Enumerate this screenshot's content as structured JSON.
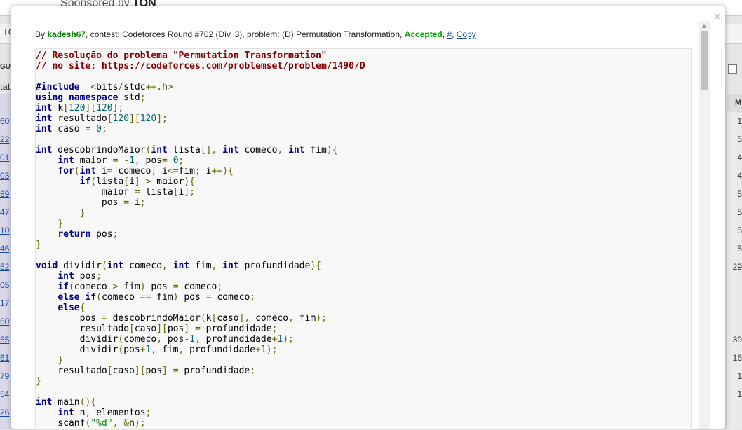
{
  "background": {
    "sponsor_prefix": "Sponsored by",
    "sponsor_brand": "TON",
    "nav_fragment": "TO",
    "gur_fragment": "GUR",
    "stat_fragment": "tat",
    "right_header": "M",
    "left_ids": [
      "60",
      "22",
      "01",
      "03",
      "89",
      "47",
      "10",
      "46",
      "52",
      "05",
      "17",
      "60",
      "55",
      "61",
      "79",
      "54",
      "26"
    ],
    "right_vals": [
      "1",
      "5",
      "4",
      "4",
      "5",
      "5",
      "5",
      "5",
      "29",
      "",
      "",
      "",
      "39",
      "16",
      "1",
      "1",
      ""
    ]
  },
  "submission": {
    "by_label": "By ",
    "author": "kadesh67",
    "contest_text": ", contest: Codeforces Round #702 (Div. 3), problem: (D) Permutation Transformation, ",
    "verdict": "Accepted",
    "sep1": ", ",
    "hash_link": "#",
    "sep2": ", ",
    "copy_link": "Copy",
    "close_symbol": "×"
  },
  "code_lines": [
    [
      [
        "cm",
        "// Resolução do problema \"Permutation Transformation\""
      ]
    ],
    [
      [
        "cm",
        "// no site: https://codeforces.com/problemset/problem/1490/D"
      ]
    ],
    [],
    [
      [
        "kw",
        "#include"
      ],
      [
        "",
        "  "
      ],
      [
        "pun",
        "<"
      ],
      [
        "",
        "bits"
      ],
      [
        "pun",
        "/"
      ],
      [
        "",
        "stdc"
      ],
      [
        "pun",
        "++."
      ],
      [
        "",
        "h"
      ],
      [
        "pun",
        ">"
      ]
    ],
    [
      [
        "kw",
        "using"
      ],
      [
        "",
        " "
      ],
      [
        "kw",
        "namespace"
      ],
      [
        "",
        " std"
      ],
      [
        "pun",
        ";"
      ]
    ],
    [
      [
        "kw",
        "int"
      ],
      [
        "",
        " k"
      ],
      [
        "pun",
        "["
      ],
      [
        "num",
        "120"
      ],
      [
        "pun",
        "]["
      ],
      [
        "num",
        "120"
      ],
      [
        "pun",
        "];"
      ]
    ],
    [
      [
        "kw",
        "int"
      ],
      [
        "",
        " resultado"
      ],
      [
        "pun",
        "["
      ],
      [
        "num",
        "120"
      ],
      [
        "pun",
        "]["
      ],
      [
        "num",
        "120"
      ],
      [
        "pun",
        "];"
      ]
    ],
    [
      [
        "kw",
        "int"
      ],
      [
        "",
        " caso "
      ],
      [
        "pun",
        "="
      ],
      [
        "",
        " "
      ],
      [
        "num",
        "0"
      ],
      [
        "pun",
        ";"
      ]
    ],
    [],
    [
      [
        "kw",
        "int"
      ],
      [
        "",
        " descobrindoMaior"
      ],
      [
        "pun",
        "("
      ],
      [
        "kw",
        "int"
      ],
      [
        "",
        " lista"
      ],
      [
        "pun",
        "[],"
      ],
      [
        "",
        " "
      ],
      [
        "kw",
        "int"
      ],
      [
        "",
        " comeco"
      ],
      [
        "pun",
        ","
      ],
      [
        "",
        " "
      ],
      [
        "kw",
        "int"
      ],
      [
        "",
        " fim"
      ],
      [
        "pun",
        "){"
      ]
    ],
    [
      [
        "",
        "    "
      ],
      [
        "kw",
        "int"
      ],
      [
        "",
        " maior "
      ],
      [
        "pun",
        "="
      ],
      [
        "",
        " "
      ],
      [
        "pun",
        "-"
      ],
      [
        "num",
        "1"
      ],
      [
        "pun",
        ","
      ],
      [
        "",
        " pos"
      ],
      [
        "pun",
        "="
      ],
      [
        "",
        " "
      ],
      [
        "num",
        "0"
      ],
      [
        "pun",
        ";"
      ]
    ],
    [
      [
        "",
        "    "
      ],
      [
        "kw",
        "for"
      ],
      [
        "pun",
        "("
      ],
      [
        "kw",
        "int"
      ],
      [
        "",
        " i"
      ],
      [
        "pun",
        "="
      ],
      [
        "",
        " comeco"
      ],
      [
        "pun",
        ";"
      ],
      [
        "",
        " i"
      ],
      [
        "pun",
        "<="
      ],
      [
        "",
        "fim"
      ],
      [
        "pun",
        ";"
      ],
      [
        "",
        " i"
      ],
      [
        "pun",
        "++){"
      ]
    ],
    [
      [
        "",
        "        "
      ],
      [
        "kw",
        "if"
      ],
      [
        "pun",
        "("
      ],
      [
        "",
        "lista"
      ],
      [
        "pun",
        "["
      ],
      [
        "",
        "i"
      ],
      [
        "pun",
        "]"
      ],
      [
        "",
        " "
      ],
      [
        "pun",
        ">"
      ],
      [
        "",
        " maior"
      ],
      [
        "pun",
        "){"
      ]
    ],
    [
      [
        "",
        "            maior "
      ],
      [
        "pun",
        "="
      ],
      [
        "",
        " lista"
      ],
      [
        "pun",
        "["
      ],
      [
        "",
        "i"
      ],
      [
        "pun",
        "];"
      ]
    ],
    [
      [
        "",
        "            pos "
      ],
      [
        "pun",
        "="
      ],
      [
        "",
        " i"
      ],
      [
        "pun",
        ";"
      ]
    ],
    [
      [
        "",
        "        "
      ],
      [
        "pun",
        "}"
      ]
    ],
    [
      [
        "",
        "    "
      ],
      [
        "pun",
        "}"
      ]
    ],
    [
      [
        "",
        "    "
      ],
      [
        "kw",
        "return"
      ],
      [
        "",
        " pos"
      ],
      [
        "pun",
        ";"
      ]
    ],
    [
      [
        "pun",
        "}"
      ]
    ],
    [],
    [
      [
        "kw",
        "void"
      ],
      [
        "",
        " dividir"
      ],
      [
        "pun",
        "("
      ],
      [
        "kw",
        "int"
      ],
      [
        "",
        " comeco"
      ],
      [
        "pun",
        ","
      ],
      [
        "",
        " "
      ],
      [
        "kw",
        "int"
      ],
      [
        "",
        " fim"
      ],
      [
        "pun",
        ","
      ],
      [
        "",
        " "
      ],
      [
        "kw",
        "int"
      ],
      [
        "",
        " profundidade"
      ],
      [
        "pun",
        "){"
      ]
    ],
    [
      [
        "",
        "    "
      ],
      [
        "kw",
        "int"
      ],
      [
        "",
        " pos"
      ],
      [
        "pun",
        ";"
      ]
    ],
    [
      [
        "",
        "    "
      ],
      [
        "kw",
        "if"
      ],
      [
        "pun",
        "("
      ],
      [
        "",
        "comeco "
      ],
      [
        "pun",
        ">"
      ],
      [
        "",
        " fim"
      ],
      [
        "pun",
        ")"
      ],
      [
        "",
        " pos "
      ],
      [
        "pun",
        "="
      ],
      [
        "",
        " comeco"
      ],
      [
        "pun",
        ";"
      ]
    ],
    [
      [
        "",
        "    "
      ],
      [
        "kw",
        "else"
      ],
      [
        "",
        " "
      ],
      [
        "kw",
        "if"
      ],
      [
        "pun",
        "("
      ],
      [
        "",
        "comeco "
      ],
      [
        "pun",
        "=="
      ],
      [
        "",
        " fim"
      ],
      [
        "pun",
        ")"
      ],
      [
        "",
        " pos "
      ],
      [
        "pun",
        "="
      ],
      [
        "",
        " comeco"
      ],
      [
        "pun",
        ";"
      ]
    ],
    [
      [
        "",
        "    "
      ],
      [
        "kw",
        "else"
      ],
      [
        "pun",
        "{"
      ]
    ],
    [
      [
        "",
        "        pos "
      ],
      [
        "pun",
        "="
      ],
      [
        "",
        " descobrindoMaior"
      ],
      [
        "pun",
        "("
      ],
      [
        "",
        "k"
      ],
      [
        "pun",
        "["
      ],
      [
        "",
        "caso"
      ],
      [
        "pun",
        "],"
      ],
      [
        "",
        " comeco"
      ],
      [
        "pun",
        ","
      ],
      [
        "",
        " fim"
      ],
      [
        "pun",
        ");"
      ]
    ],
    [
      [
        "",
        "        resultado"
      ],
      [
        "pun",
        "["
      ],
      [
        "",
        "caso"
      ],
      [
        "pun",
        "]["
      ],
      [
        "",
        "pos"
      ],
      [
        "pun",
        "]"
      ],
      [
        "",
        " "
      ],
      [
        "pun",
        "="
      ],
      [
        "",
        " profundidade"
      ],
      [
        "pun",
        ";"
      ]
    ],
    [
      [
        "",
        "        dividir"
      ],
      [
        "pun",
        "("
      ],
      [
        "",
        "comeco"
      ],
      [
        "pun",
        ","
      ],
      [
        "",
        " pos"
      ],
      [
        "pun",
        "-"
      ],
      [
        "num",
        "1"
      ],
      [
        "pun",
        ","
      ],
      [
        "",
        " profundidade"
      ],
      [
        "pun",
        "+"
      ],
      [
        "num",
        "1"
      ],
      [
        "pun",
        ");"
      ]
    ],
    [
      [
        "",
        "        dividir"
      ],
      [
        "pun",
        "("
      ],
      [
        "",
        "pos"
      ],
      [
        "pun",
        "+"
      ],
      [
        "num",
        "1"
      ],
      [
        "pun",
        ","
      ],
      [
        "",
        " fim"
      ],
      [
        "pun",
        ","
      ],
      [
        "",
        " profundidade"
      ],
      [
        "pun",
        "+"
      ],
      [
        "num",
        "1"
      ],
      [
        "pun",
        ");"
      ]
    ],
    [
      [
        "",
        "    "
      ],
      [
        "pun",
        "}"
      ]
    ],
    [
      [
        "",
        "    resultado"
      ],
      [
        "pun",
        "["
      ],
      [
        "",
        "caso"
      ],
      [
        "pun",
        "]["
      ],
      [
        "",
        "pos"
      ],
      [
        "pun",
        "]"
      ],
      [
        "",
        " "
      ],
      [
        "pun",
        "="
      ],
      [
        "",
        " profundidade"
      ],
      [
        "pun",
        ";"
      ]
    ],
    [
      [
        "pun",
        "}"
      ]
    ],
    [],
    [
      [
        "kw",
        "int"
      ],
      [
        "",
        " main"
      ],
      [
        "pun",
        "(){"
      ]
    ],
    [
      [
        "",
        "    "
      ],
      [
        "kw",
        "int"
      ],
      [
        "",
        " n"
      ],
      [
        "pun",
        ","
      ],
      [
        "",
        " elementos"
      ],
      [
        "pun",
        ";"
      ]
    ],
    [
      [
        "",
        "    scanf"
      ],
      [
        "pun",
        "("
      ],
      [
        "str",
        "\"%d\""
      ],
      [
        "pun",
        ","
      ],
      [
        "",
        " "
      ],
      [
        "pun",
        "&"
      ],
      [
        "",
        "n"
      ],
      [
        "pun",
        ");"
      ]
    ]
  ]
}
